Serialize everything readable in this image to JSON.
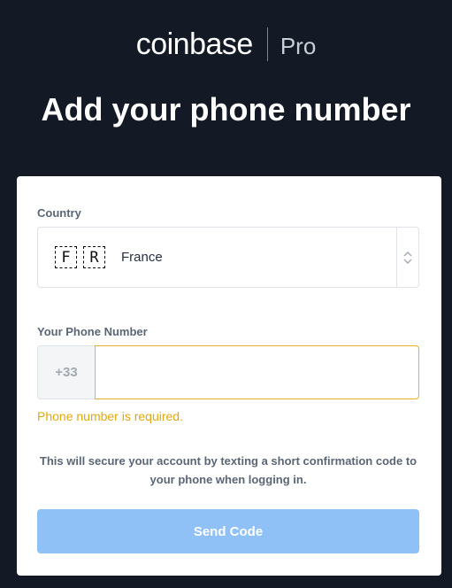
{
  "header": {
    "logo_text": "coinbase",
    "logo_suffix": "Pro",
    "title": "Add your phone number"
  },
  "form": {
    "country_label": "Country",
    "country": {
      "flag_letters": [
        "F",
        "R"
      ],
      "name": "France"
    },
    "phone_label": "Your Phone Number",
    "phone_prefix": "+33",
    "phone_value": "",
    "error_text": "Phone number is required.",
    "info_text": "This will secure your account by texting a short confirmation code to your phone when logging in.",
    "submit_label": "Send Code"
  },
  "colors": {
    "background": "#141a25",
    "error": "#e3a80f",
    "button": "#8fc1f6",
    "input_focus_border": "#e9b02d"
  }
}
